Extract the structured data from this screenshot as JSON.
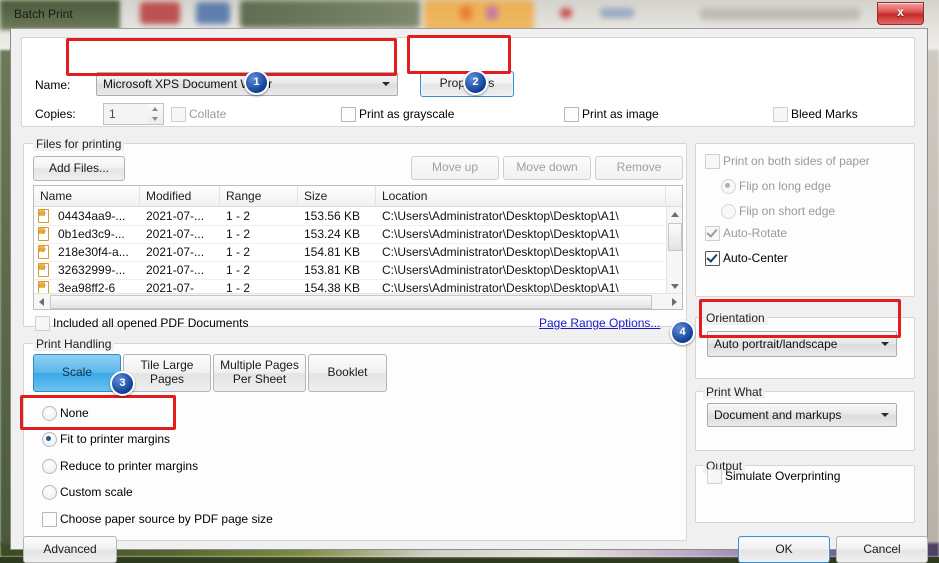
{
  "window": {
    "title": "Batch Print",
    "close_label": "x"
  },
  "printer": {
    "name_label": "Name:",
    "name_value": "Microsoft XPS Document Writer",
    "properties_label": "Properties",
    "copies_label": "Copies:",
    "copies_value": "1",
    "collate_label": "Collate",
    "print_as_grayscale_label": "Print as grayscale",
    "print_as_image_label": "Print as image",
    "bleed_marks_label": "Bleed Marks"
  },
  "files": {
    "group_label": "Files for printing",
    "add_files_label": "Add Files...",
    "move_up_label": "Move up",
    "move_down_label": "Move down",
    "remove_label": "Remove",
    "columns": [
      "Name",
      "Modified",
      "Range",
      "Size",
      "Location"
    ],
    "rows": [
      {
        "name": "04434aa9-...",
        "modified": "2021-07-...",
        "range": "1 - 2",
        "size": "153.56 KB",
        "location": "C:\\Users\\Administrator\\Desktop\\Desktop\\A1\\"
      },
      {
        "name": "0b1ed3c9-...",
        "modified": "2021-07-...",
        "range": "1 - 2",
        "size": "153.24 KB",
        "location": "C:\\Users\\Administrator\\Desktop\\Desktop\\A1\\"
      },
      {
        "name": "218e30f4-a...",
        "modified": "2021-07-...",
        "range": "1 - 2",
        "size": "154.81 KB",
        "location": "C:\\Users\\Administrator\\Desktop\\Desktop\\A1\\"
      },
      {
        "name": "32632999-...",
        "modified": "2021-07-...",
        "range": "1 - 2",
        "size": "153.81 KB",
        "location": "C:\\Users\\Administrator\\Desktop\\Desktop\\A1\\"
      },
      {
        "name": "3ea98ff2-6",
        "modified": "2021-07-",
        "range": "1 - 2",
        "size": "154.38 KB",
        "location": "C:\\Users\\Administrator\\Desktop\\Desktop\\A1\\"
      }
    ],
    "include_opened_label": "Included all opened PDF Documents",
    "page_range_options_label": "Page Range Options..."
  },
  "print_handling": {
    "group_label": "Print Handling",
    "tabs": [
      {
        "label": "Scale",
        "selected": true
      },
      {
        "label": "Tile Large Pages",
        "selected": false
      },
      {
        "label": "Multiple Pages Per Sheet",
        "selected": false
      },
      {
        "label": "Booklet",
        "selected": false
      }
    ],
    "radios": [
      {
        "label": "None",
        "selected": false
      },
      {
        "label": "Fit to printer margins",
        "selected": true
      },
      {
        "label": "Reduce to printer margins",
        "selected": false
      },
      {
        "label": "Custom scale",
        "selected": false
      }
    ],
    "choose_paper_source_label": "Choose paper source by PDF page size"
  },
  "duplex": {
    "both_sides_label": "Print on both sides of paper",
    "flip_long_label": "Flip on long edge",
    "flip_short_label": "Flip on short edge",
    "auto_rotate_label": "Auto-Rotate",
    "auto_center_label": "Auto-Center"
  },
  "orientation": {
    "group_label": "Orientation",
    "value": "Auto portrait/landscape"
  },
  "print_what": {
    "group_label": "Print What",
    "value": "Document and markups"
  },
  "output": {
    "group_label": "Output",
    "simulate_overprinting_label": "Simulate Overprinting"
  },
  "footer": {
    "advanced_label": "Advanced",
    "ok_label": "OK",
    "cancel_label": "Cancel"
  },
  "annotations": {
    "badges": [
      "1",
      "2",
      "3",
      "4"
    ],
    "highlight_color": "#e31d1d",
    "badge_color": "#0f3f96"
  }
}
